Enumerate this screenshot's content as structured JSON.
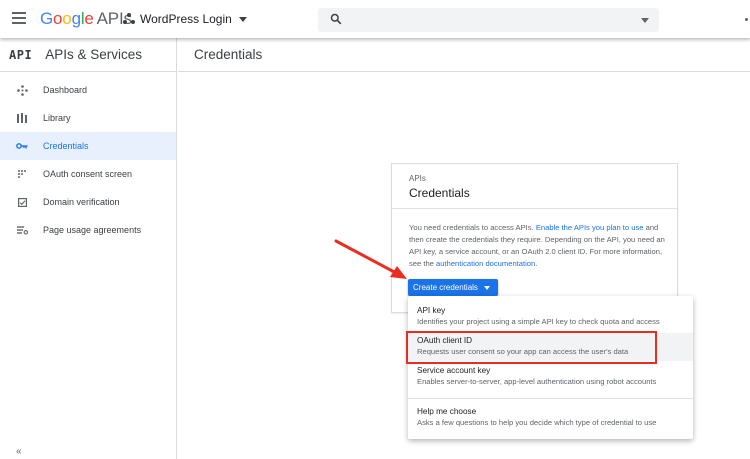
{
  "header": {
    "logo_google": "Google",
    "logo_apis": "APIs",
    "project_name": "WordPress Login",
    "search_placeholder": ""
  },
  "sidebar": {
    "api_glyph": "API",
    "title": "APIs & Services",
    "items": [
      {
        "label": "Dashboard",
        "icon": "dashboard-icon"
      },
      {
        "label": "Library",
        "icon": "library-icon"
      },
      {
        "label": "Credentials",
        "icon": "key-icon",
        "active": true
      },
      {
        "label": "OAuth consent screen",
        "icon": "consent-icon"
      },
      {
        "label": "Domain verification",
        "icon": "checkbox-icon"
      },
      {
        "label": "Page usage agreements",
        "icon": "settings-list-icon"
      }
    ],
    "collapse_label": "«"
  },
  "main": {
    "page_title": "Credentials"
  },
  "card": {
    "kicker": "APIs",
    "title": "Credentials",
    "text_1": "You need credentials to access APIs.",
    "link_1": "Enable the APIs you plan to use",
    "text_2": "and then create the credentials they require. Depending on the API, you need an API key, a service account, or an OAuth 2.0 client ID. For more information, see the",
    "link_2": "authentication documentation",
    "text_3": ".",
    "create_button": "Create credentials"
  },
  "menu": {
    "items": [
      {
        "title": "API key",
        "desc": "Identifies your project using a simple API key to check quota and access"
      },
      {
        "title": "OAuth client ID",
        "desc": "Requests user consent so your app can access the user's data"
      },
      {
        "title": "Service account key",
        "desc": "Enables server-to-server, app-level authentication using robot accounts"
      },
      {
        "title": "Help me choose",
        "desc": "Asks a few questions to help you decide which type of credential to use"
      }
    ]
  },
  "colors": {
    "accent": "#1a73e8",
    "highlight_box": "#ea2d22"
  }
}
